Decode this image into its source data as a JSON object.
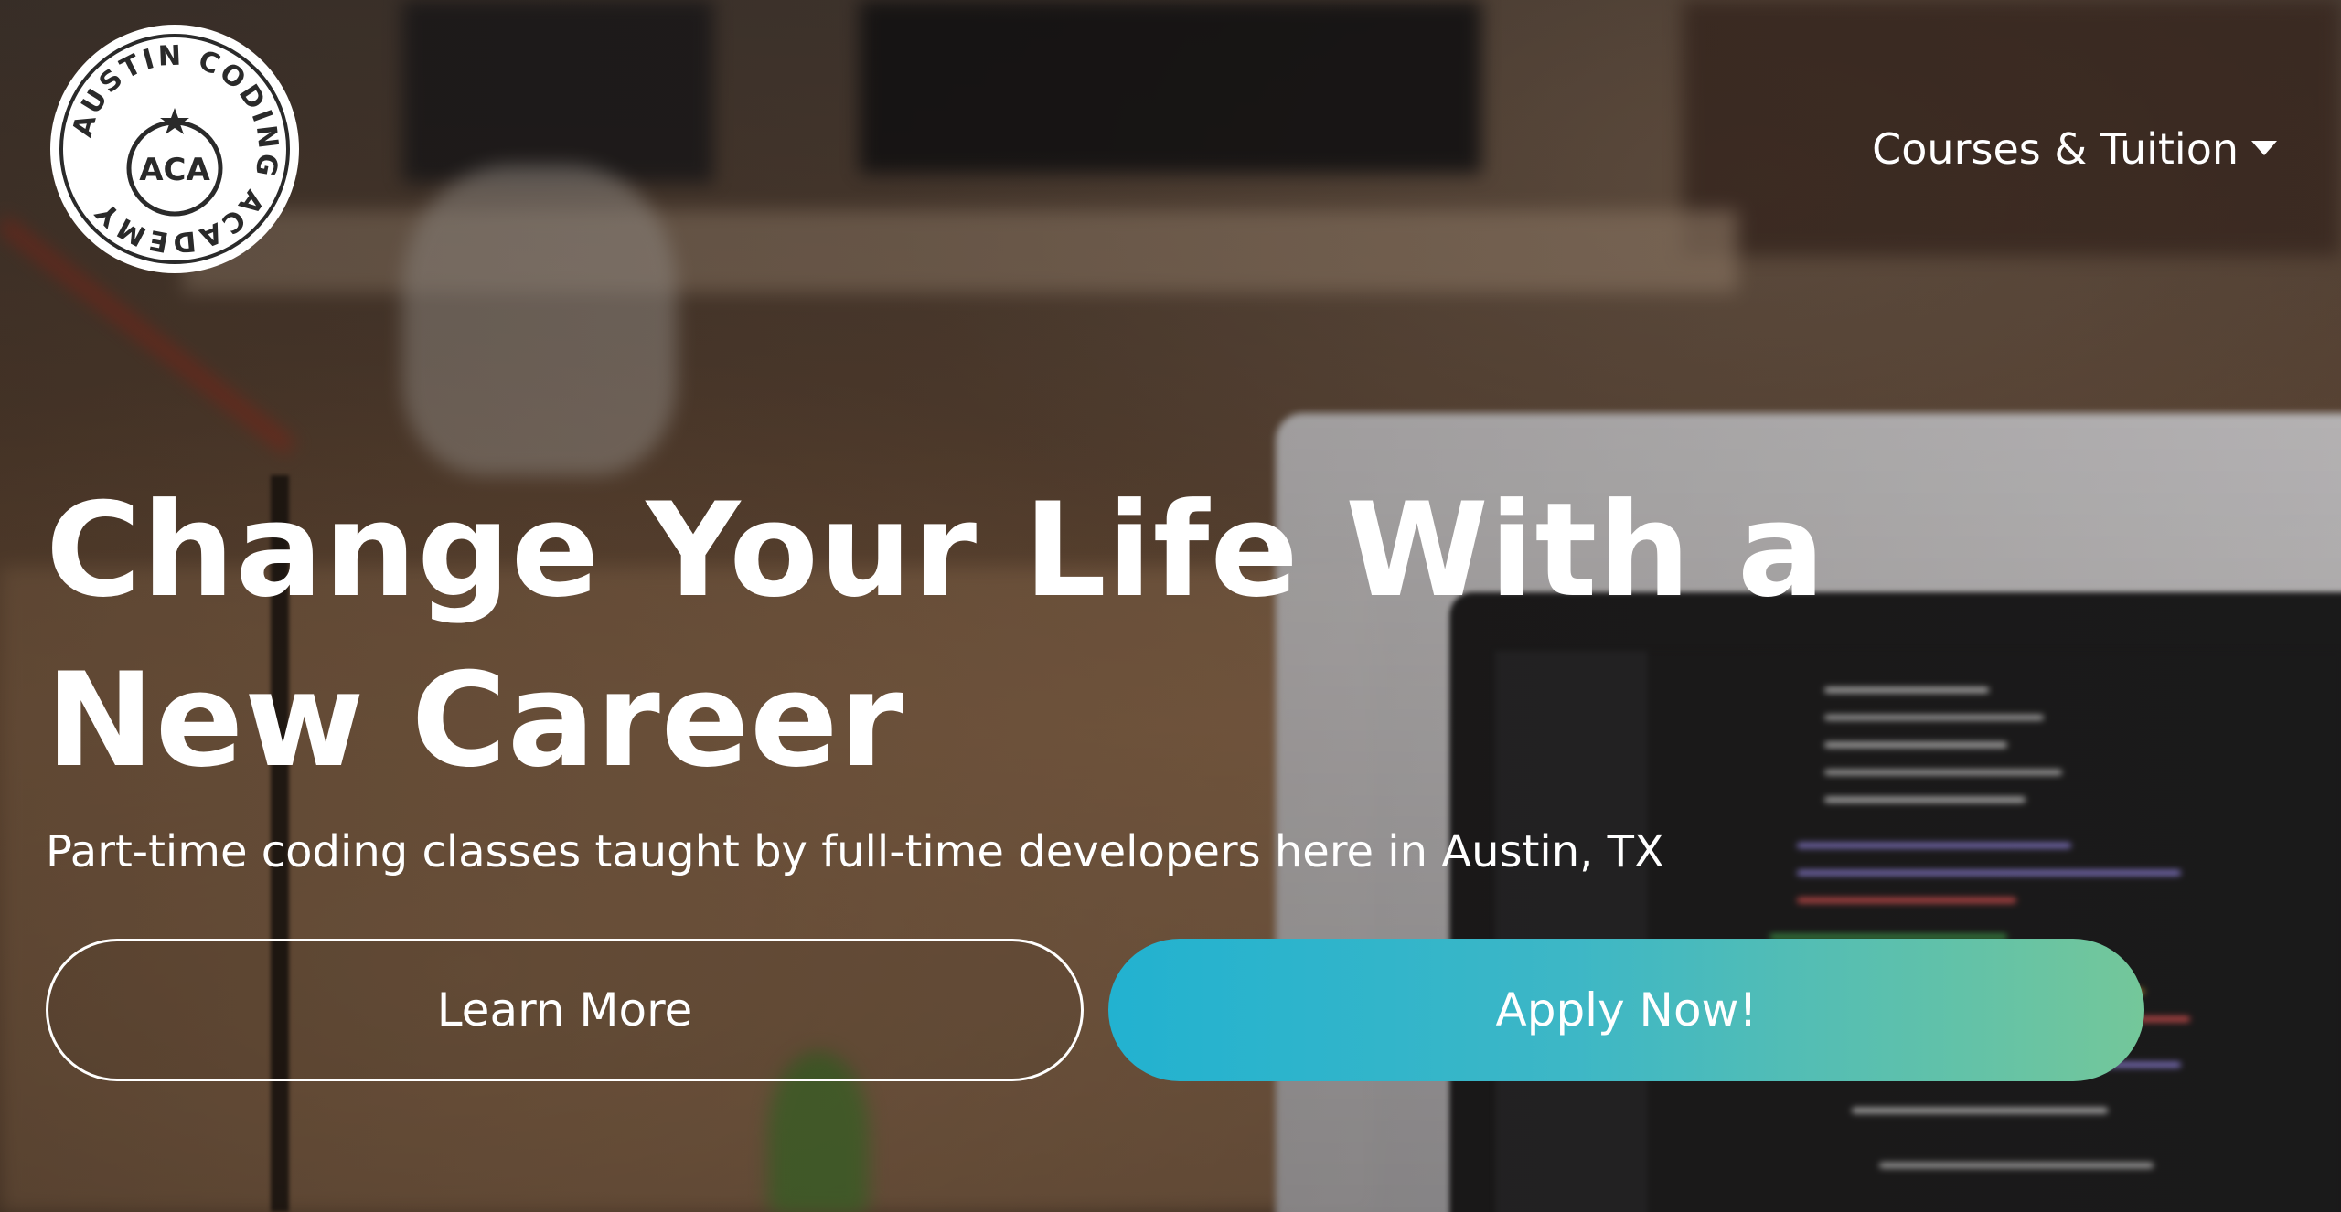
{
  "logo": {
    "ring_text": "AUSTIN CODING ACADEMY",
    "center_text": "ACA",
    "icon": "star-icon"
  },
  "nav": {
    "courses_label": "Courses & Tuition",
    "caret_icon": "chevron-down-icon"
  },
  "hero": {
    "headline": "Change Your Life With a New Career",
    "subheadline": "Part-time coding classes taught by full-time developers here in Austin, TX",
    "learn_more_label": "Learn More",
    "apply_label": "Apply Now!"
  },
  "colors": {
    "apply_gradient_start": "#22b2d0",
    "apply_gradient_end": "#74c79a",
    "text": "#ffffff"
  }
}
